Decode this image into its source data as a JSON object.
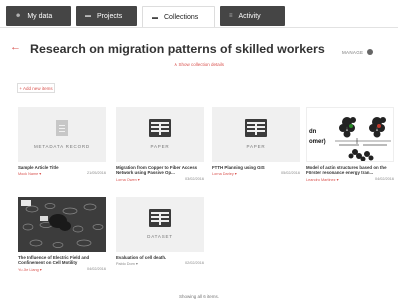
{
  "tabs": [
    {
      "label": "My data",
      "icon": "user-icon"
    },
    {
      "label": "Projects",
      "icon": "folder-icon"
    },
    {
      "label": "Collections",
      "icon": "collection-icon"
    },
    {
      "label": "Activity",
      "icon": "activity-icon"
    }
  ],
  "header": {
    "title": "Research on migration patterns of skilled workers",
    "manage_label": "MANAGE",
    "details_link": "∧ Show collection details"
  },
  "add_item_label": "+ Add new items",
  "items": [
    {
      "thumb_label": "METADATA RECORD",
      "title": "Sample Article Title",
      "author": "Mock Name ▾",
      "date": "21/05/2016"
    },
    {
      "thumb_label": "PAPER",
      "title": "Migration from Copper to Fiber Access Network using Passive Op...",
      "author": "Lorna Owen ▾",
      "date": "03/02/2016"
    },
    {
      "thumb_label": "PAPER",
      "title": "FTTH Planning using GIS",
      "author": "Lorna Darley ▾",
      "date": "05/02/2016"
    },
    {
      "thumb_label": "",
      "thumb_text_1": "dn",
      "thumb_text_2": "omer)",
      "title": "Model of actin structures based on the Förster resonance energy tran...",
      "author": "Leandro Martinez ▾",
      "date": "04/02/2016"
    },
    {
      "thumb_label": "",
      "title": "The Influence of Electric Field and Confinement on Cell Motility",
      "author": "Yu Jie Liang ▾",
      "date": "04/02/2016"
    },
    {
      "thumb_label": "DATASET",
      "title": "Evaluation of cell death.",
      "author": "Pablo Dom ▾",
      "date": "02/02/2016"
    }
  ],
  "footer": "Showing all 6 items."
}
